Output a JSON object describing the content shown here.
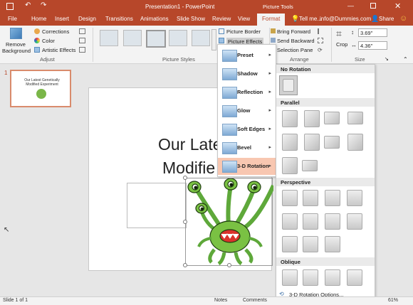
{
  "titlebar": {
    "title": "Presentation1 - PowerPoint",
    "tools": "Picture Tools",
    "account": "info@Dummies.com",
    "share": "Share",
    "tell": "Tell me..."
  },
  "tabs": [
    "File",
    "Home",
    "Insert",
    "Design",
    "Transitions",
    "Animations",
    "Slide Show",
    "Review",
    "View",
    "Format"
  ],
  "ribbon": {
    "remove_bg": [
      "Remove",
      "Background"
    ],
    "corrections": "Corrections",
    "color": "Color",
    "artistic": "Artistic Effects",
    "adjust": "Adjust",
    "picture_styles": "Picture Styles",
    "border": "Picture Border",
    "effects": "Picture Effects",
    "bring_forward": "Bring Forward",
    "send_backward": "Send Backward",
    "selection_pane": "Selection Pane",
    "arrange": "Arrange",
    "crop": "Crop",
    "height": "3.69\"",
    "width": "4.36\"",
    "size": "Size"
  },
  "thumbnail": {
    "number": "1",
    "text": "Our Latest Genetically Modified Experiment"
  },
  "slide": {
    "title_line1": "Our Late",
    "title_line2": "Modifie"
  },
  "effects_menu": [
    "Preset",
    "Shadow",
    "Reflection",
    "Glow",
    "Soft Edges",
    "Bevel",
    "3-D Rotation"
  ],
  "rotation_panel": {
    "no_rotation": "No Rotation",
    "parallel": "Parallel",
    "perspective": "Perspective",
    "oblique": "Oblique",
    "options": "3-D Rotation Options..."
  },
  "status": {
    "slide": "Slide 1 of 1",
    "notes": "Notes",
    "comments": "Comments",
    "zoom": "61%"
  },
  "colors": {
    "accent": "#b7472a",
    "highlight": "#f8c7b1"
  }
}
